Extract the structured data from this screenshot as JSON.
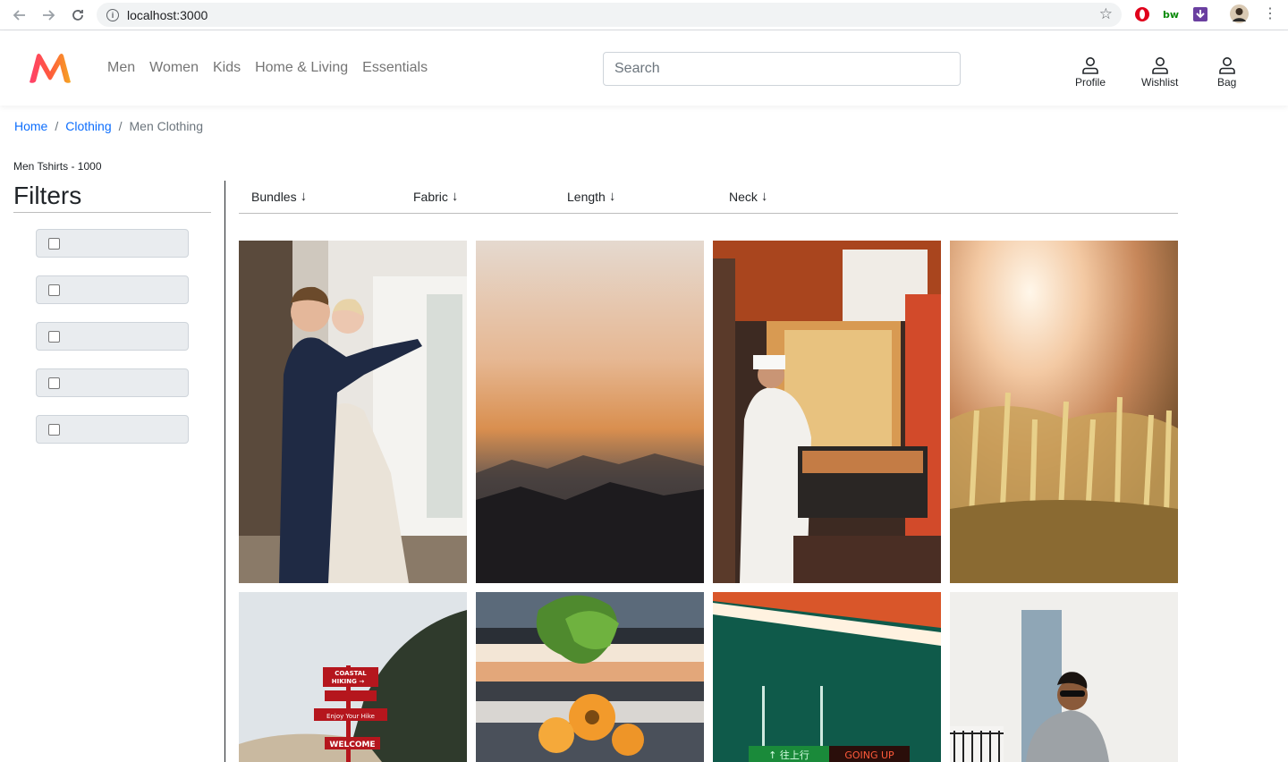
{
  "browser": {
    "url": "localhost:3000"
  },
  "brand": {
    "accent": "#ff3f6c",
    "accent2": "#f5a623"
  },
  "nav": {
    "links": [
      "Men",
      "Women",
      "Kids",
      "Home & Living",
      "Essentials"
    ]
  },
  "search": {
    "placeholder": "Search",
    "value": ""
  },
  "header_actions": {
    "profile": "Profile",
    "wishlist": "Wishlist",
    "bag": "Bag"
  },
  "breadcrumb": {
    "home": "Home",
    "clothing": "Clothing",
    "current": "Men Clothing",
    "separator": "/"
  },
  "listing": {
    "count_label": "Men Tshirts - 1000"
  },
  "sidebar": {
    "title": "Filters",
    "filters": [
      {
        "label": "",
        "checked": false
      },
      {
        "label": "",
        "checked": false
      },
      {
        "label": "",
        "checked": false
      },
      {
        "label": "",
        "checked": false
      },
      {
        "label": "",
        "checked": false
      }
    ]
  },
  "sort_options": [
    "Bundles",
    "Fabric",
    "Length",
    "Neck"
  ],
  "sort_arrow": "↓",
  "products": [
    {
      "image": "wedding-couple-photo"
    },
    {
      "image": "sunset-mountains-photo"
    },
    {
      "image": "street-food-cook-photo"
    },
    {
      "image": "sunlit-wheat-field-photo"
    },
    {
      "image": "coastal-hiking-sign-photo"
    },
    {
      "image": "sunflower-bouquet-photo"
    },
    {
      "image": "neon-teal-ceiling-photo"
    },
    {
      "image": "man-sunglasses-sweater-photo"
    }
  ],
  "status_colors": {
    "link": "#0d6efd",
    "muted": "#6c757d"
  }
}
